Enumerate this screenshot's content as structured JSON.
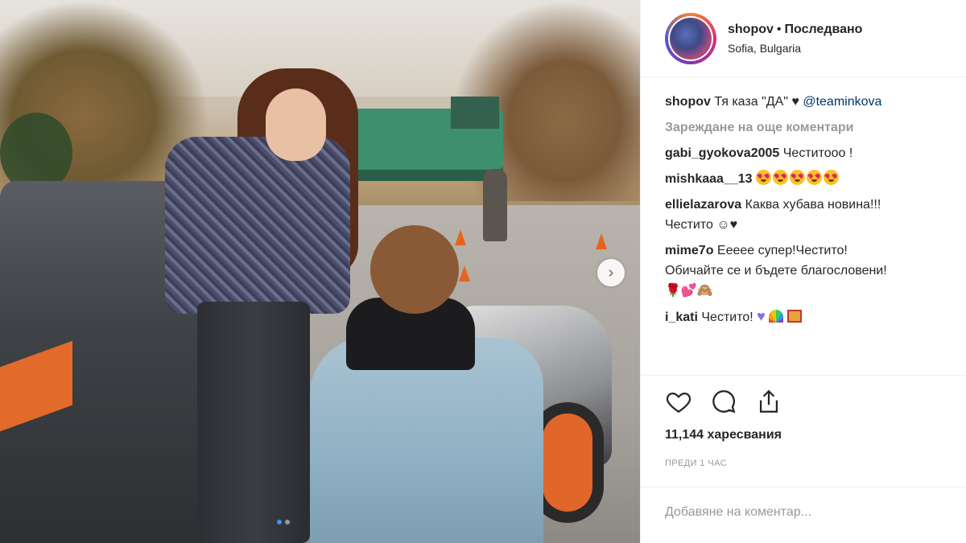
{
  "header": {
    "username": "shopov",
    "separator": "•",
    "follow_status": "Последвано",
    "location": "Sofia, Bulgaria"
  },
  "caption": {
    "username": "shopov",
    "text": "Тя каза \"ДА\" ♥",
    "mention": "@teaminkova"
  },
  "load_more": "Зареждане на още коментари",
  "comments": [
    {
      "username": "gabi_gyokova2005",
      "text": "Честитооо !"
    },
    {
      "username": "mishkaaa__13",
      "text": ""
    },
    {
      "username": "ellielazarova",
      "text": "Каква хубава новина!!!",
      "text2": "Честито ☺♥"
    },
    {
      "username": "mime7o",
      "text": "Ееееe супер!Честито!",
      "text2": "Обичайте се и бъдете благословени!",
      "text3": "🌹💕🙈"
    },
    {
      "username": "i_kati",
      "text": "Честито!"
    }
  ],
  "likes": "11,144 харесвания",
  "timestamp": "ПРЕДИ 1 ЧАС",
  "add_comment_placeholder": "Добавяне на коментар...",
  "icons": {
    "like": "heart-icon",
    "comment": "comment-icon",
    "share": "share-icon",
    "next": "chevron-right-icon"
  },
  "colors": {
    "mention": "#003569",
    "muted": "#999999",
    "text": "#262626"
  }
}
